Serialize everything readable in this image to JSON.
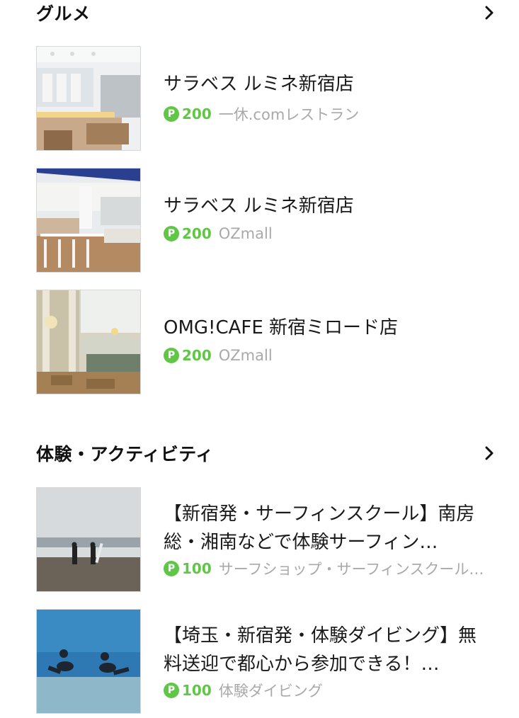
{
  "colors": {
    "points": "#5fc745",
    "source": "#a9a9a9"
  },
  "gourmet": {
    "title": "グルメ",
    "items": [
      {
        "name": "サラベス ルミネ新宿店",
        "badge": "P",
        "points": "200",
        "source": "一休.comレストラン"
      },
      {
        "name": "サラベス ルミネ新宿店",
        "badge": "P",
        "points": "200",
        "source": "OZmall"
      },
      {
        "name": "OMG!CAFE 新宿ミロード店",
        "badge": "P",
        "points": "200",
        "source": "OZmall"
      }
    ]
  },
  "activity": {
    "title": "体験・アクティビティ",
    "items": [
      {
        "name": "【新宿発・サーフィンスクール】南房総・湘南などで体験サーフィン…",
        "badge": "P",
        "points": "100",
        "source": "サーフショップ・サーフィンスクール…"
      },
      {
        "name": "【埼玉・新宿発・体験ダイビング】無料送迎で都心から参加できる！…",
        "badge": "P",
        "points": "100",
        "source": "体験ダイビング"
      }
    ]
  }
}
